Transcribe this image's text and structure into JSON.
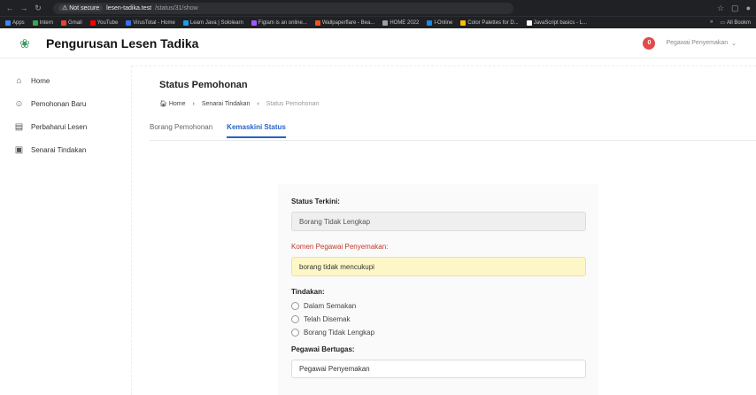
{
  "browser": {
    "security": "Not secure",
    "host": "lesen-tadika.test",
    "path": "/status/31/show",
    "bookmarks": [
      {
        "label": "Apps",
        "color": "#4285f4"
      },
      {
        "label": "Intern",
        "color": "#34a853"
      },
      {
        "label": "Gmail",
        "color": "#ea4335"
      },
      {
        "label": "YouTube",
        "color": "#ff0000"
      },
      {
        "label": "VirusTotal - Home",
        "color": "#3a6ff7"
      },
      {
        "label": "Learn Java | Sololearn",
        "color": "#149ef2"
      },
      {
        "label": "Figlam is an online...",
        "color": "#a259ff"
      },
      {
        "label": "Wallpaperflare - Bea...",
        "color": "#f4511e"
      },
      {
        "label": "HOME 2022",
        "color": "#9aa0a6"
      },
      {
        "label": "I-Online",
        "color": "#1e88e5"
      },
      {
        "label": "Color Palettes for D...",
        "color": "#fbbc05"
      },
      {
        "label": "JavaScript basics - L...",
        "color": "#ffffff"
      }
    ],
    "all_bookmarks": "All Bookm"
  },
  "header": {
    "title": "Pengurusan Lesen Tadika",
    "notification_count": "0",
    "user": "Pegawai Penyemakan"
  },
  "sidebar": {
    "items": [
      {
        "label": "Home",
        "icon": "home-icon"
      },
      {
        "label": "Pemohonan Baru",
        "icon": "users-icon"
      },
      {
        "label": "Perbaharui Lesen",
        "icon": "card-icon"
      },
      {
        "label": "Senarai Tindakan",
        "icon": "clipboard-icon"
      }
    ]
  },
  "page": {
    "title": "Status Pemohonan",
    "breadcrumb": [
      "Home",
      "Senarai Tindakan",
      "Status Pemohonan"
    ],
    "tabs": [
      "Borang Pemohonan",
      "Kemaskini Status"
    ]
  },
  "form": {
    "status_label": "Status Terkini:",
    "status_value": "Borang Tidak Lengkap",
    "comment_label": "Komen Pegawai Penyemakan:",
    "comment_value": "borang tidak mencukupi",
    "action_label": "Tindakan:",
    "options": [
      "Dalam Semakan",
      "Telah Disemak",
      "Borang Tidak Lengkap"
    ],
    "officer_label": "Pegawai Bertugas:",
    "officer_value": "Pegawai Penyemakan"
  }
}
